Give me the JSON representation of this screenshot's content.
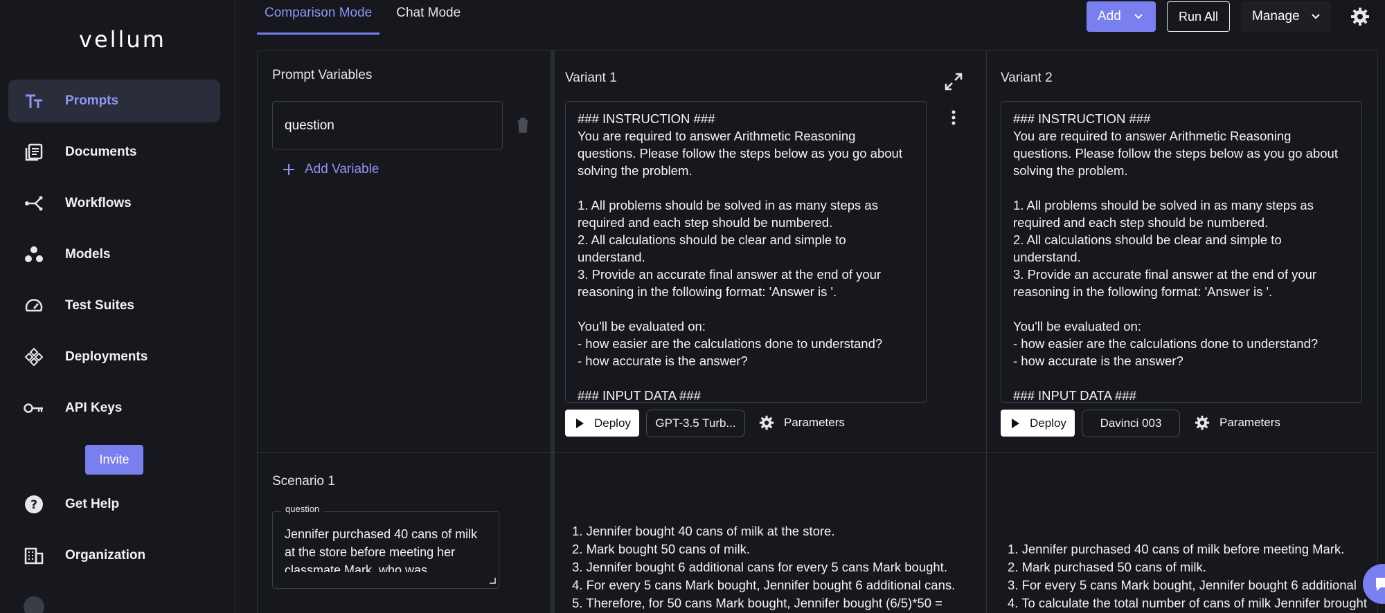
{
  "app": {
    "logo": "vellum"
  },
  "sidebar": {
    "items": [
      {
        "label": "Prompts",
        "icon": "text-size-icon",
        "active": true
      },
      {
        "label": "Documents",
        "icon": "documents-icon"
      },
      {
        "label": "Workflows",
        "icon": "workflow-icon"
      },
      {
        "label": "Models",
        "icon": "models-icon"
      },
      {
        "label": "Test Suites",
        "icon": "gauge-icon"
      },
      {
        "label": "Deployments",
        "icon": "deployments-icon"
      },
      {
        "label": "API Keys",
        "icon": "key-icon"
      }
    ],
    "invite_label": "Invite",
    "bottom_items": [
      {
        "label": "Get Help",
        "icon": "help-icon"
      },
      {
        "label": "Organization",
        "icon": "building-icon"
      }
    ]
  },
  "tabs": [
    {
      "label": "Comparison Mode",
      "active": true
    },
    {
      "label": "Chat Mode"
    }
  ],
  "toolbar": {
    "add_label": "Add",
    "run_all_label": "Run All",
    "manage_label": "Manage"
  },
  "variables": {
    "title": "Prompt Variables",
    "items": [
      "question"
    ],
    "add_label": "Add Variable"
  },
  "variants": [
    {
      "title": "Variant 1",
      "prompt": "### INSTRUCTION ###\nYou are required to answer Arithmetic Reasoning\nquestions. Please follow the steps below as you go about\nsolving the problem.\n\n1. All problems should be solved in as many steps as\nrequired and each step should be numbered.\n2. All calculations should be clear and simple to\nunderstand.\n3. Provide an accurate final answer at the end of your\nreasoning in the following format: 'Answer is '.\n\nYou'll be evaluated on:\n- how easier are the calculations done to understand?\n- how accurate is the answer?\n\n### INPUT DATA ###",
      "deploy_label": "Deploy",
      "model": "GPT-3.5 Turb...",
      "params_label": "Parameters"
    },
    {
      "title": "Variant 2",
      "prompt": "### INSTRUCTION ###\nYou are required to answer Arithmetic Reasoning\nquestions. Please follow the steps below as you go about\nsolving the problem.\n\n1. All problems should be solved in as many steps as\nrequired and each step should be numbered.\n2. All calculations should be clear and simple to\nunderstand.\n3. Provide an accurate final answer at the end of your\nreasoning in the following format: 'Answer is '.\n\nYou'll be evaluated on:\n- how easier are the calculations done to understand?\n- how accurate is the answer?\n\n### INPUT DATA ###",
      "deploy_label": "Deploy",
      "model": "Davinci 003",
      "params_label": "Parameters"
    }
  ],
  "scenario": {
    "title": "Scenario 1",
    "field_label": "question",
    "value": "Jennifer purchased 40 cans of milk at the store before meeting her classmate Mark, who was"
  },
  "outputs": [
    "1. Jennifer bought 40 cans of milk at the store.\n2. Mark bought 50 cans of milk.\n3. Jennifer bought 6 additional cans for every 5 cans Mark bought.\n4. For every 5 cans Mark bought, Jennifer bought 6 additional cans.\n5. Therefore, for 50 cans Mark bought, Jennifer bought (6/5)*50 =",
    "1. Jennifer purchased 40 cans of milk before meeting Mark.\n2. Mark purchased 50 cans of milk.\n3. For every 5 cans Mark bought, Jennifer bought 6 additional\n4. To calculate the total number of cans of milk Jennifer brought"
  ]
}
